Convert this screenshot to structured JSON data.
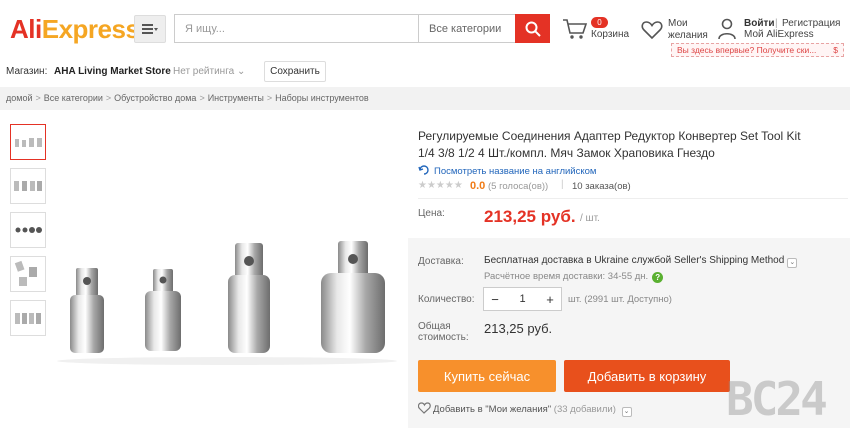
{
  "header": {
    "logo_main": "Ali",
    "logo_accent": "Express",
    "logo_reg": "®",
    "search_placeholder": "Я ищу...",
    "search_category": "Все категории",
    "cart_count": "0",
    "cart_label": "Корзина",
    "wishlist_line1": "Мои",
    "wishlist_line2": "желания",
    "login": "Войти",
    "separator": "|",
    "register": "Регистрация",
    "my_account": "Мой AliExpress",
    "promo_text": "Вы здесь впервые? Получите ски...",
    "promo_symbol": "$"
  },
  "store": {
    "label": "Магазин:",
    "name": "AHA Living Market Store",
    "rating": "Нет рейтинга",
    "save_label": "Сохранить"
  },
  "breadcrumb": [
    "домой",
    "Все категории",
    "Обустройство дома",
    "Инструменты",
    "Наборы инструментов"
  ],
  "product": {
    "title": "Регулируемые Соединения Адаптер Редуктор Конвертер Set Tool Kit 1/4 3/8 1/2 4 Шт./компл. Мяч Замок Храповика Гнездо",
    "translate_link": "Посмотреть название на английском",
    "stars": "★★★★★",
    "score": "0.0",
    "votes": "(5 голоса(ов))",
    "vote_separator": "|",
    "orders": "10 заказа(ов)",
    "price_label": "Цена:",
    "price": "213,25 руб.",
    "per_unit": "/ шт.",
    "shipping_label": "Доставка:",
    "shipping_main": "Бесплатная доставка в Ukraine службой Seller's Shipping Method",
    "shipping_time": "Расчётное время доставки: 34-55 дн.",
    "quantity_label": "Количество:",
    "quantity": "1",
    "qty_minus": "−",
    "qty_plus": "+",
    "quantity_info": "шт. (2991 шт. Доступно)",
    "total_label_1": "Общая",
    "total_label_2": "стоимость:",
    "total": "213,25 руб.",
    "buy_now": "Купить сейчас",
    "add_to_cart": "Добавить в корзину",
    "wishlist_add": "Добавить в \"Мои желания\"",
    "wishlist_count": "(33 добавили)"
  },
  "watermark": "BC24",
  "colors": {
    "brand_red": "#e43225",
    "brand_orange": "#f7902c",
    "cart_button": "#e8501c",
    "link_blue": "#2266bb"
  }
}
